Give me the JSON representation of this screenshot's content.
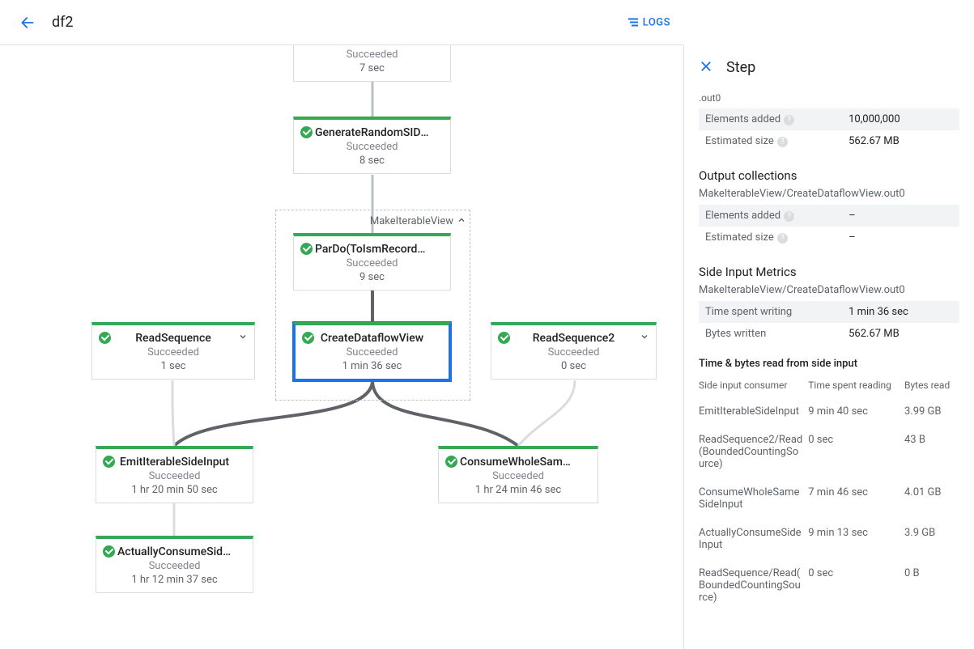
{
  "header": {
    "title": "df2",
    "logs_label": "LOGS"
  },
  "graph": {
    "group_label": "MakeIterableView",
    "nodes": {
      "top_cut": {
        "status": "Succeeded",
        "time": "7 sec"
      },
      "gen": {
        "title": "GenerateRandomSIData",
        "status": "Succeeded",
        "time": "8 sec"
      },
      "pardo": {
        "title": "ParDo(ToIsmRecordFor…",
        "status": "Succeeded",
        "time": "9 sec"
      },
      "createview": {
        "title": "CreateDataflowView",
        "status": "Succeeded",
        "time": "1 min 36 sec"
      },
      "readseq": {
        "title": "ReadSequence",
        "status": "Succeeded",
        "time": "1 sec"
      },
      "readseq2": {
        "title": "ReadSequence2",
        "status": "Succeeded",
        "time": "0 sec"
      },
      "emit": {
        "title": "EmitIterableSideInput",
        "status": "Succeeded",
        "time": "1 hr 20 min 50 sec"
      },
      "consume": {
        "title": "ConsumeWholeSameSi…",
        "status": "Succeeded",
        "time": "1 hr 24 min 46 sec"
      },
      "actually": {
        "title": "ActuallyConsumeSideI…",
        "status": "Succeeded",
        "time": "1 hr 12 min 37 sec"
      }
    }
  },
  "panel": {
    "title": "Step",
    "cut_text": ".out0",
    "top_kv": [
      {
        "k": "Elements added",
        "v": "10,000,000",
        "help": true
      },
      {
        "k": "Estimated size",
        "v": "562.67 MB",
        "help": true
      }
    ],
    "output_section": "Output collections",
    "output_sub": "MakeIterableView/CreateDataflowView.out0",
    "output_kv": [
      {
        "k": "Elements added",
        "v": "–",
        "help": true
      },
      {
        "k": "Estimated size",
        "v": "–",
        "help": true
      }
    ],
    "side_section": "Side Input Metrics",
    "side_sub": "MakeIterableView/CreateDataflowView.out0",
    "side_kv": [
      {
        "k": "Time spent writing",
        "v": "1 min 36 sec"
      },
      {
        "k": "Bytes written",
        "v": "562.67 MB"
      }
    ],
    "read_header": "Time & bytes read from side input",
    "read_cols": [
      "Side input consumer",
      "Time spent reading",
      "Bytes read"
    ],
    "read_rows": [
      {
        "consumer": "EmitIterableSideInput",
        "time": "9 min 40 sec",
        "bytes": "3.99 GB"
      },
      {
        "consumer": "ReadSequence2/Read(BoundedCountingSource)",
        "time": "0 sec",
        "bytes": "43 B"
      },
      {
        "consumer": "ConsumeWholeSameSideInput",
        "time": "7 min 46 sec",
        "bytes": "4.01 GB"
      },
      {
        "consumer": "ActuallyConsumeSideInput",
        "time": "9 min 13 sec",
        "bytes": "3.9 GB"
      },
      {
        "consumer": "ReadSequence/Read(BoundedCountingSource)",
        "time": "0 sec",
        "bytes": "0 B"
      }
    ]
  }
}
